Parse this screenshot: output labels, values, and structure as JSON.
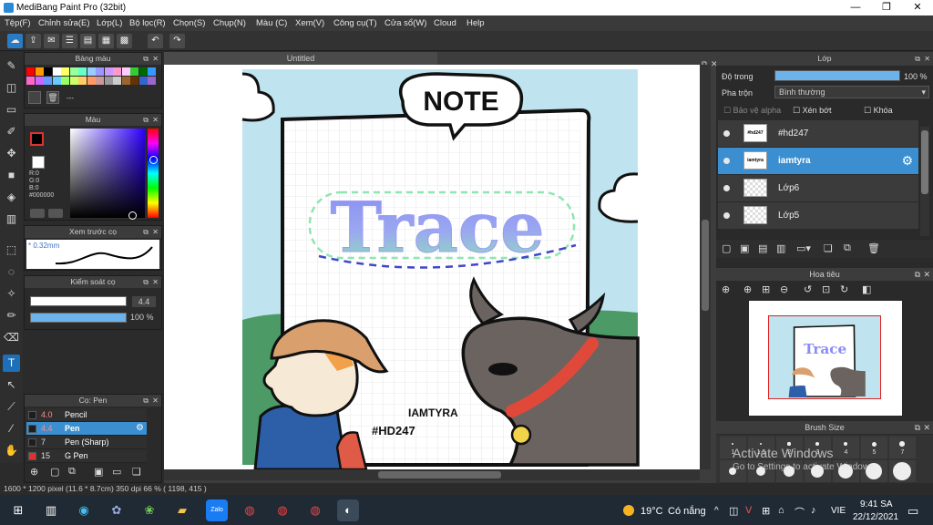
{
  "window": {
    "title": "MediBang Paint Pro (32bit)",
    "minimize": "—",
    "maximize": "❐",
    "close": "✕"
  },
  "menu": [
    "Tệp(F)",
    "Chỉnh sửa(E)",
    "Lớp(L)",
    "Bộ lọc(R)",
    "Chọn(S)",
    "Chụp(N)",
    "Màu (C)",
    "Xem(V)",
    "Công cụ(T)",
    "Cửa sổ(W)",
    "Cloud",
    "Help"
  ],
  "document": {
    "tab_title": "Untitled"
  },
  "panels": {
    "palette_title": "Bảng màu",
    "palette_placeholder": "---",
    "color_title": "Màu",
    "color_rgb": [
      "R:0",
      "G:0",
      "B:0"
    ],
    "color_hex": "#000000",
    "brush_preview_title": "Xem trước cọ",
    "brush_preview_size": "0.32mm",
    "brush_control_title": "Kiểm soát cọ",
    "brush_size_value": "4.4",
    "brush_opacity_value": "100 %",
    "brush_size_fill": 1.0,
    "brush_opacity_fill": 1.0,
    "brush_list_title": "Cọ: Pen",
    "brushes": [
      {
        "size": "4.0",
        "name": "Pencil",
        "selected": false
      },
      {
        "size": "4.4",
        "name": "Pen",
        "selected": true
      },
      {
        "size": "7",
        "name": "Pen (Sharp)",
        "selected": false
      },
      {
        "size": "15",
        "name": "G Pen",
        "selected": false
      }
    ]
  },
  "layers_panel": {
    "title": "Lớp",
    "opacity_label": "Độ trong",
    "opacity_value": "100 %",
    "opacity_fill": 1.0,
    "blend_label": "Pha trộn",
    "blend_value": "Bình thường",
    "protect_alpha": "Bảo vệ alpha",
    "clipping": "Xén bớt",
    "lock": "Khóa",
    "layers": [
      {
        "name": "#hd247",
        "selected": false
      },
      {
        "name": "iamtyra",
        "selected": true
      },
      {
        "name": "Lớp6",
        "selected": false
      },
      {
        "name": "Lớp5",
        "selected": false
      }
    ]
  },
  "navigator": {
    "title": "Hoa tiêu"
  },
  "brush_size_panel": {
    "title": "Brush Size",
    "sizes": [
      "1",
      "1.5",
      "2",
      "3",
      "4",
      "5",
      "7"
    ]
  },
  "watermark": {
    "line1": "Activate Windows",
    "line2": "Go to Settings to activate Windows."
  },
  "artwork": {
    "note": "NOTE",
    "trace": "Trace",
    "author": "IAMTYRA",
    "tag": "#HD247"
  },
  "status": "1600 * 1200 pixel   (11.6 * 8.7cm)   350 dpi   66 %   ( 1198, 415 )",
  "taskbar": {
    "weather_temp": "19°C",
    "weather_text": "Có nắng",
    "lang": "VIE",
    "time": "9:41 SA",
    "date": "22/12/2021"
  },
  "colors": {
    "accent": "#3b8fd0",
    "sky": "#bde3ef",
    "trace_purple": "#8a90f0",
    "trace_green": "#8ee6b0",
    "scarf": "#e0493a",
    "buffalo": "#6b6360"
  }
}
